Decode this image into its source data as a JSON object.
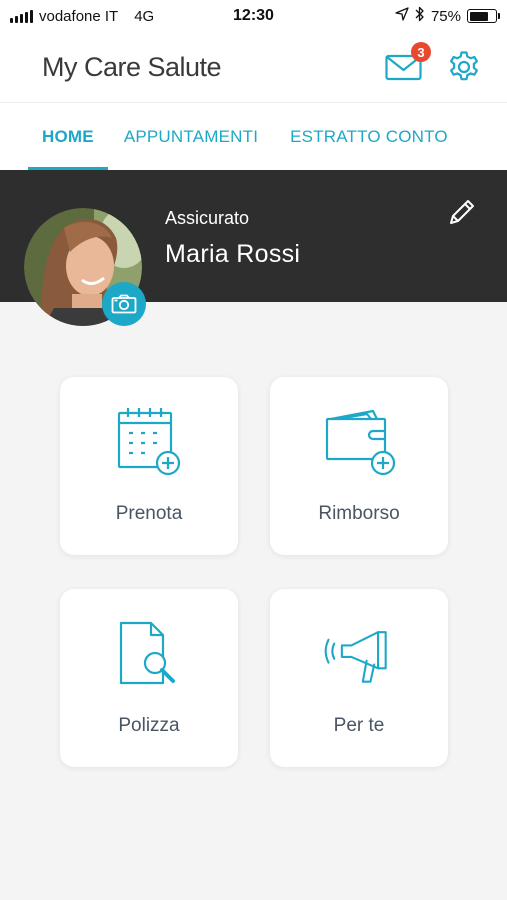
{
  "status_bar": {
    "carrier": "vodafone IT",
    "network": "4G",
    "time": "12:30",
    "battery": "75%",
    "battery_level": 0.75
  },
  "header": {
    "logo": "My Care Salute",
    "mail_badge": "3"
  },
  "tabs": [
    {
      "label": "HOME",
      "active": true
    },
    {
      "label": "APPUNTAMENTI",
      "active": false
    },
    {
      "label": "ESTRATTO CONTO",
      "active": false
    }
  ],
  "profile": {
    "role": "Assicurato",
    "name": "Maria Rossi"
  },
  "tiles": [
    {
      "label": "Prenota",
      "icon": "calendar-add-icon"
    },
    {
      "label": "Rimborso",
      "icon": "wallet-add-icon"
    },
    {
      "label": "Polizza",
      "icon": "document-search-icon"
    },
    {
      "label": "Per te",
      "icon": "megaphone-icon"
    }
  ],
  "colors": {
    "accent": "#1ea8c8",
    "badge": "#e8482d",
    "profile_band": "#2e2e2e"
  }
}
